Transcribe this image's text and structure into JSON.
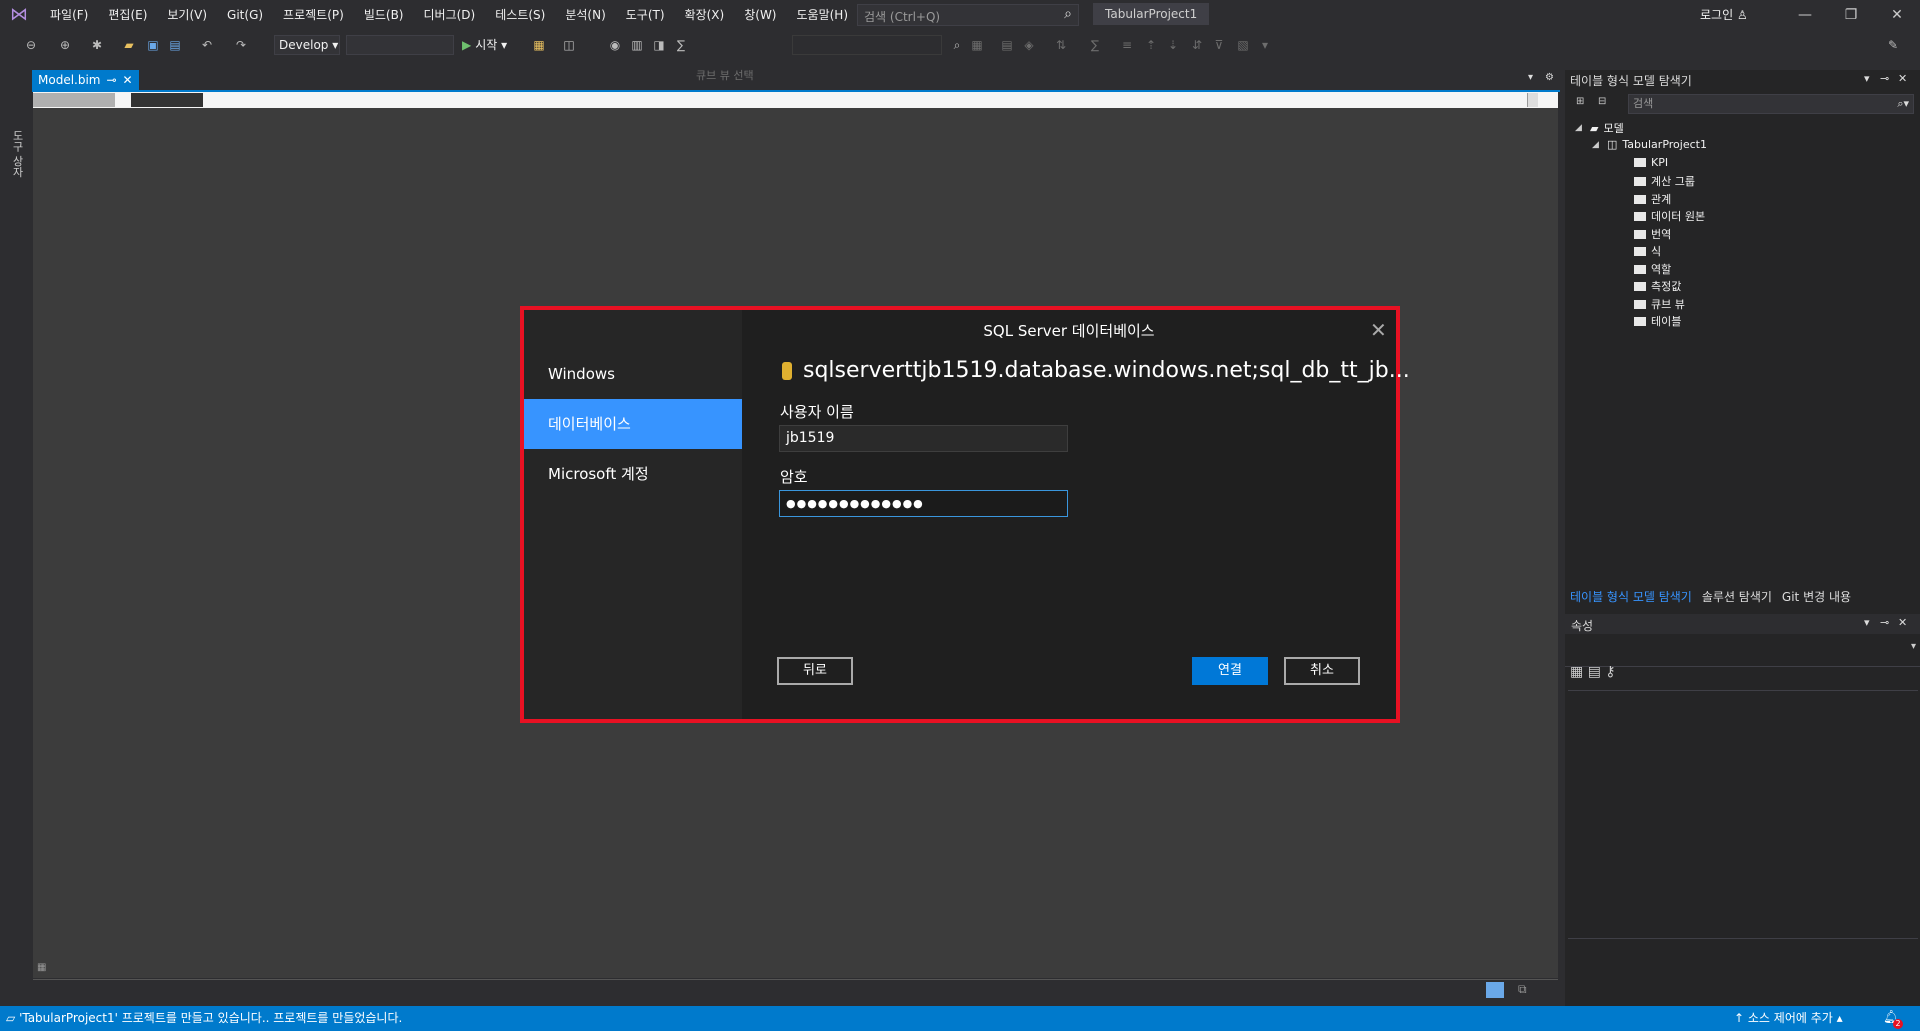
{
  "menubar": {
    "items": [
      "파일(F)",
      "편집(E)",
      "보기(V)",
      "Git(G)",
      "프로젝트(P)",
      "빌드(B)",
      "디버그(D)",
      "테스트(S)",
      "분석(N)",
      "도구(T)",
      "확장(X)",
      "창(W)",
      "도움말(H)"
    ],
    "search_placeholder": "검색 (Ctrl+Q)",
    "project_title": "TabularProject1",
    "login": "로그인"
  },
  "toolbar": {
    "config": "Develop",
    "start": "시작",
    "cube_select": "큐브 뷰 선택"
  },
  "left_strip": {
    "toolbox_label": "도구 상자"
  },
  "document": {
    "tab_label": "Model.bim"
  },
  "dialog": {
    "title": "SQL Server 데이터베이스",
    "nav": [
      "Windows",
      "데이터베이스",
      "Microsoft 계정"
    ],
    "server": "sqlserverttjb1519.database.windows.net;sql_db_tt_jb...",
    "username_label": "사용자 이름",
    "username_value": "jb1519",
    "password_label": "암호",
    "password_value": "●●●●●●●●●●●●●",
    "back_label": "뒤로",
    "connect_label": "연결",
    "cancel_label": "취소"
  },
  "right_panel": {
    "title": "테이블 형식 모델 탐색기",
    "search_placeholder": "검색",
    "root": "모델",
    "project": "TabularProject1",
    "items": [
      "KPI",
      "계산 그룹",
      "관계",
      "데이터 원본",
      "번역",
      "식",
      "역할",
      "측정값",
      "큐브 뷰",
      "테이블"
    ],
    "tabs": [
      "테이블 형식 모델 탐색기",
      "솔루션 탐색기",
      "Git 변경 내용"
    ],
    "properties_title": "속성"
  },
  "statusbar": {
    "message": "'TabularProject1' 프로젝트를 만들고 있습니다.. 프로젝트를 만들었습니다.",
    "source_control": "소스 제어에 추가",
    "notifications": "2"
  }
}
